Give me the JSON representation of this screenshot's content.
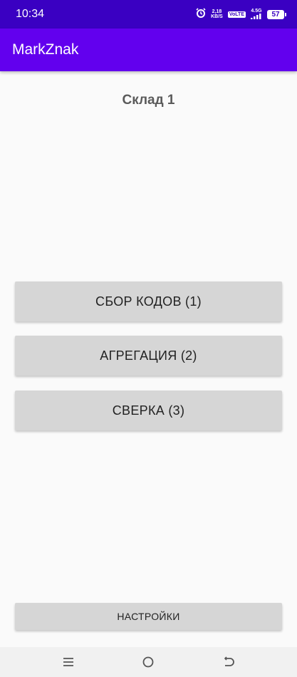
{
  "status_bar": {
    "time": "10:34",
    "speed_value": "2,18",
    "speed_unit": "KB/S",
    "volte": "VoLTE",
    "network": "4.5G",
    "battery": "57",
    "icons": [
      "alarm-icon",
      "signal-icon",
      "battery-icon"
    ]
  },
  "app_bar": {
    "title": "MarkZnak",
    "color": "#6200ee"
  },
  "warehouse_title": "Склад 1",
  "menu": {
    "collect_codes": "СБОР КОДОВ (1)",
    "aggregation": "АГРЕГАЦИЯ (2)",
    "reconciliation": "СВЕРКА (3)"
  },
  "settings_label": "НАСТРОЙКИ",
  "nav_bar": {
    "icons": [
      "menu-icon",
      "home-icon",
      "back-icon"
    ]
  }
}
